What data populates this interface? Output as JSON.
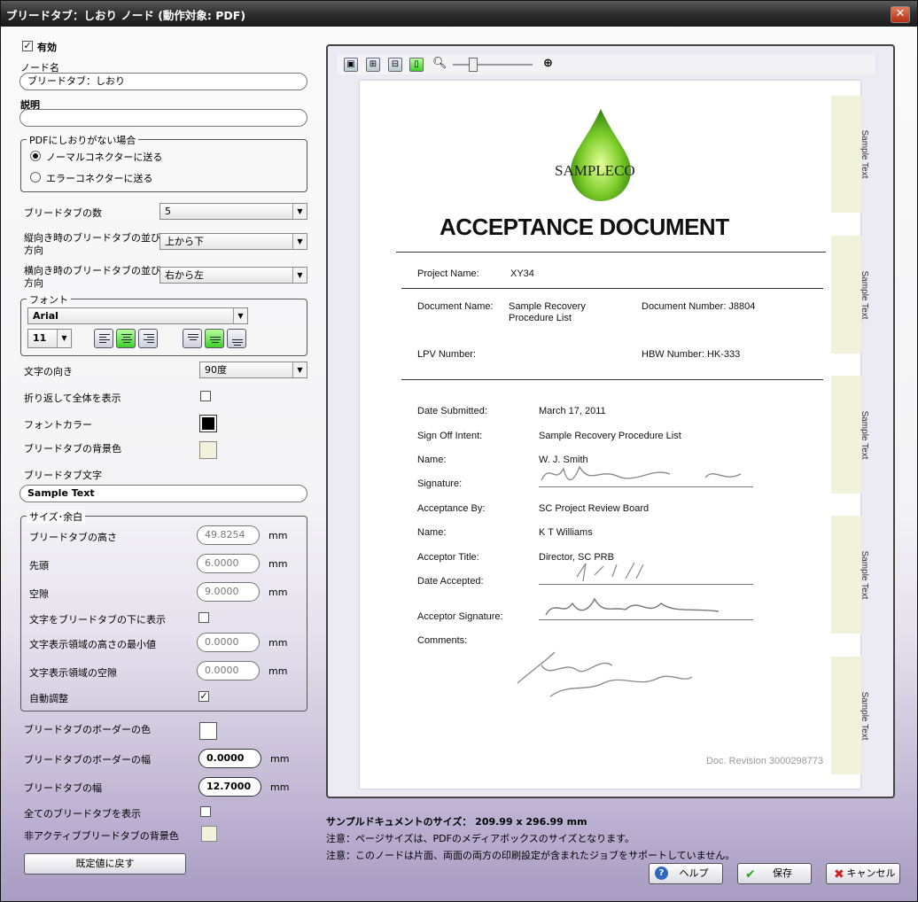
{
  "window": {
    "title": "ブリードタブ：しおり ノード (動作対象: PDF)"
  },
  "form": {
    "enabled_label": "有効",
    "node_name_label": "ノード名",
    "node_name_value": "ブリードタブ：しおり",
    "desc_label": "説明",
    "desc_value": "",
    "nobookmark_group": "PDFにしおりがない場合",
    "radio_normal": "ノーマルコネクターに送る",
    "radio_error": "エラーコネクターに送る",
    "tab_count_label": "ブリードタブの数",
    "tab_count_value": "5",
    "portrait_label_1": "縦向き時のブリードタブの並び",
    "portrait_label_2": "方向",
    "portrait_value": "上から下",
    "landscape_label_1": "横向き時のブリードタブの並び",
    "landscape_label_2": "方向",
    "landscape_value": "右から左",
    "font_group": "フォント",
    "font_value": "Arial",
    "font_size_value": "11",
    "text_dir_label": "文字の向き",
    "text_dir_value": "90度",
    "wrap_label": "折り返して全体を表示",
    "font_color_label": "フォントカラー",
    "tab_bg_label": "ブリードタブの背景色",
    "tab_text_label": "ブリードタブ文字",
    "tab_text_value": "Sample Text",
    "size_group": "サイズ･余白",
    "height_label": "ブリードタブの高さ",
    "height_value": "49.8254",
    "lead_label": "先頭",
    "lead_value": "6.0000",
    "gap_label": "空隙",
    "gap_value": "9.0000",
    "below_label": "文字をブリードタブの下に表示",
    "minh_label": "文字表示領域の高さの最小値",
    "minh_value": "0.0000",
    "textgap_label": "文字表示領域の空隙",
    "textgap_value": "0.0000",
    "auto_label": "自動調整",
    "border_color_label": "ブリードタブのボーダーの色",
    "border_width_label": "ブリードタブのボーダーの幅",
    "border_width_value": "0.0000",
    "tab_width_label": "ブリードタブの幅",
    "tab_width_value": "12.7000",
    "show_all_label": "全てのブリードタブを表示",
    "inactive_bg_label": "非アクティブブリードタブの背景色",
    "unit": "mm",
    "reset_button": "既定値に戻す"
  },
  "colors": {
    "font_color": "#000000",
    "tab_bg": "#f1f2da",
    "border_color": "#ffffff",
    "inactive_bg": "#f1f2da",
    "accent_green": "#3ed12a"
  },
  "toolbar": {
    "zoom_level": 0.3
  },
  "document": {
    "logo_text": "SAMPLECO",
    "heading": "ACCEPTANCE DOCUMENT",
    "project_label": "Project Name:",
    "project_value": "XY34",
    "docname_label": "Document Name:",
    "docname_value_1": "Sample Recovery",
    "docname_value_2": "Procedure List",
    "docnum_label": "Document Number: J8804",
    "lpv_label": "LPV Number:",
    "hbw_label": "HBW Number: HK-333",
    "rows": [
      {
        "label": "Date Submitted:",
        "value": "March 17, 2011"
      },
      {
        "label": "Sign Off Intent:",
        "value": "Sample Recovery Procedure List"
      },
      {
        "label": "Name:",
        "value": "W. J. Smith"
      },
      {
        "label": "Signature:",
        "value": ""
      },
      {
        "label": "Acceptance By:",
        "value": "SC Project Review Board"
      },
      {
        "label": "Name:",
        "value": "K T Williams"
      },
      {
        "label": "Acceptor Title:",
        "value": "Director, SC PRB"
      },
      {
        "label": "Date Accepted:",
        "value": ""
      }
    ],
    "acceptor_sig_label": "Acceptor Signature:",
    "comments_label": "Comments:",
    "revision": "Doc. Revision 3000298773",
    "tab_text": "Sample Text"
  },
  "footer": {
    "size_text": "サンプルドキュメントのサイズ： 209.99 x 296.99 mm",
    "note1": "注意：ページサイズは、PDFのメディアボックスのサイズとなります。",
    "note2": "注意：このノードは片面、両面の両方の印刷設定が含まれたジョブをサポートしていません。",
    "help_button": "ヘルプ",
    "save_button": "保存",
    "cancel_button": "キャンセル"
  }
}
